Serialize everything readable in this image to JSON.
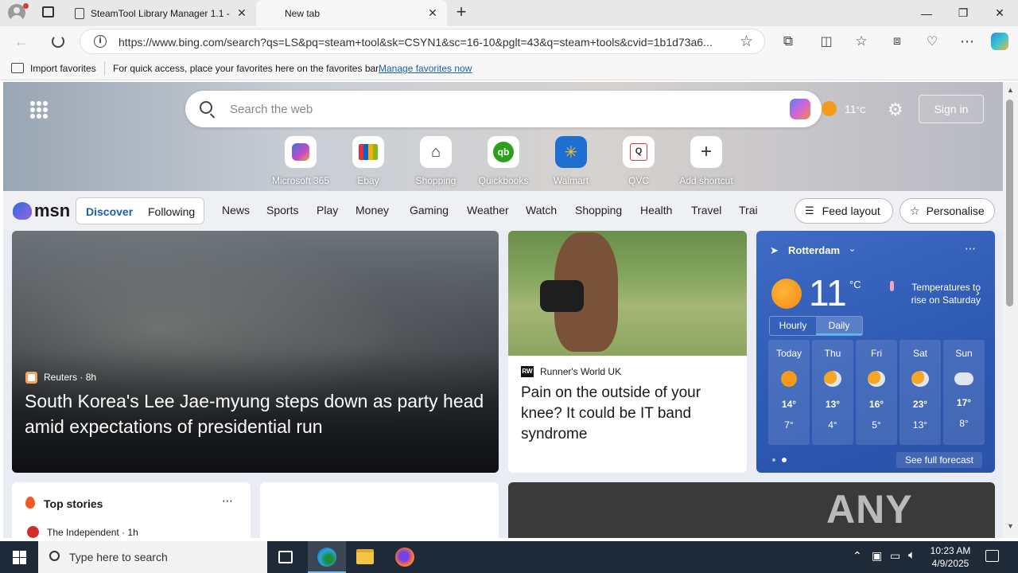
{
  "browser": {
    "tabs": [
      {
        "title": "SteamTool Library Manager 1.1 -"
      },
      {
        "title": "New tab"
      }
    ],
    "url": "https://www.bing.com/search?qs=LS&pq=steam+tool&sk=CSYN1&sc=16-10&pglt=43&q=steam+tools&cvid=1b1d73a6...",
    "favorites": {
      "import_label": "Import favorites",
      "hint": "For quick access, place your favorites here on the favorites bar.",
      "manage_link": "Manage favorites now"
    }
  },
  "newtab": {
    "search_placeholder": "Search the web",
    "temp_header": "11",
    "temp_unit": "°C",
    "sign_in": "Sign in",
    "shortcuts": [
      {
        "label": "Microsoft 365",
        "icon": "microsoft365-icon"
      },
      {
        "label": "Ebay",
        "icon": "ebay-icon"
      },
      {
        "label": "Shopping",
        "icon": "tag-icon"
      },
      {
        "label": "Quickbooks",
        "icon": "quickbooks-icon"
      },
      {
        "label": "Walmart",
        "icon": "walmart-icon"
      },
      {
        "label": "QVC",
        "icon": "qvc-icon"
      },
      {
        "label": "Add shortcut",
        "icon": "plus-icon"
      }
    ]
  },
  "msn": {
    "logo": "msn",
    "tabs": [
      "Discover",
      "Following"
    ],
    "nav": [
      "News",
      "Sports",
      "Play",
      "Money",
      "Gaming",
      "Weather",
      "Watch",
      "Shopping",
      "Health",
      "Travel",
      "Trai"
    ],
    "feed_layout": "Feed layout",
    "personalise": "Personalise"
  },
  "main_story": {
    "source": "Reuters",
    "age": "8h",
    "headline": "South Korea's Lee Jae-myung steps down as party head amid expectations of presidential run"
  },
  "side_story": {
    "source": "Runner's World UK",
    "headline": "Pain on the outside of your knee? It could be IT band syndrome"
  },
  "weather": {
    "location": "Rotterdam",
    "temp": "11",
    "unit": "°C",
    "note": "Temperatures to rise on Saturday",
    "toggle": [
      "Hourly",
      "Daily"
    ],
    "days": [
      {
        "name": "Today",
        "hi": "14°",
        "lo": "7°",
        "icon": "sun-icon"
      },
      {
        "name": "Thu",
        "hi": "13°",
        "lo": "4°",
        "icon": "partly-cloudy-icon"
      },
      {
        "name": "Fri",
        "hi": "16°",
        "lo": "5°",
        "icon": "partly-cloudy-icon"
      },
      {
        "name": "Sat",
        "hi": "23°",
        "lo": "13°",
        "icon": "partly-cloudy-icon"
      },
      {
        "name": "Sun",
        "hi": "17°",
        "lo": "8°",
        "icon": "rain-icon"
      }
    ],
    "forecast_link": "See full forecast"
  },
  "top_stories": {
    "title": "Top stories",
    "source": "The Independent",
    "age": "1h"
  },
  "watermark": "ANY RUN",
  "taskbar": {
    "search_placeholder": "Type here to search",
    "time": "10:23 AM",
    "date": "4/9/2025"
  }
}
